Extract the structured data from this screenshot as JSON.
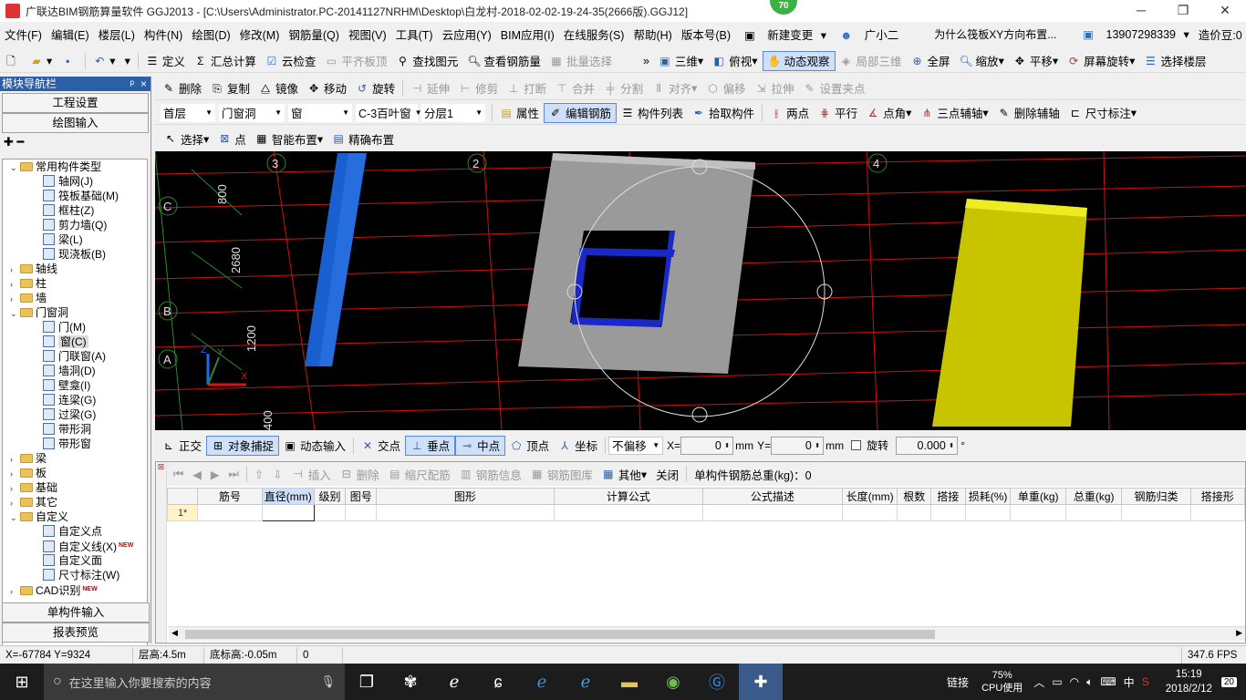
{
  "window": {
    "title": "广联达BIM钢筋算量软件 GGJ2013 - [C:\\Users\\Administrator.PC-20141127NRHM\\Desktop\\白龙村-2018-02-02-19-24-35(2666版).GGJ12]",
    "badge": "70",
    "minimize": "─",
    "restore": "❐",
    "close": "✕"
  },
  "menu": {
    "items": [
      "文件(F)",
      "编辑(E)",
      "楼层(L)",
      "构件(N)",
      "绘图(D)",
      "修改(M)",
      "钢筋量(Q)",
      "视图(V)",
      "工具(T)",
      "云应用(Y)",
      "BIM应用(I)",
      "在线服务(S)",
      "帮助(H)",
      "版本号(B)"
    ],
    "new_change": "新建变更",
    "assistant": "广小二",
    "question": "为什么筏板XY方向布置...",
    "phone": "13907298339",
    "beans": "造价豆:0"
  },
  "toolbar1": {
    "items": [
      "定义",
      "汇总计算",
      "云检查",
      "平齐板顶",
      "查找图元",
      "查看钢筋量",
      "批量选择"
    ],
    "view_items": [
      "三维",
      "俯视",
      "动态观察",
      "局部三维",
      "全屏",
      "缩放",
      "平移",
      "屏幕旋转",
      "选择楼层"
    ]
  },
  "toolbar2": {
    "items": [
      "删除",
      "复制",
      "镜像",
      "移动",
      "旋转",
      "延伸",
      "修剪",
      "打断",
      "合并",
      "分割",
      "对齐",
      "偏移",
      "拉伸",
      "设置夹点"
    ]
  },
  "toolbar3": {
    "floor": "首层",
    "category": "门窗洞",
    "type": "窗",
    "component": "C-3百叶窗",
    "layer": "分层1",
    "items": [
      "属性",
      "编辑钢筋",
      "构件列表",
      "拾取构件",
      "两点",
      "平行",
      "点角",
      "三点辅轴",
      "删除辅轴",
      "尺寸标注"
    ]
  },
  "toolbar4": {
    "items": [
      "选择",
      "点",
      "智能布置",
      "精确布置"
    ]
  },
  "left_panel": {
    "header": "模块导航栏",
    "header_pin": "ᵖ",
    "header_close": "×",
    "btn_project": "工程设置",
    "btn_draw": "绘图输入",
    "btn_single": "单构件输入",
    "btn_report": "报表预览",
    "tree": [
      {
        "label": "常用构件类型",
        "level": 0,
        "folder": true,
        "expanded": true
      },
      {
        "label": "轴网(J)",
        "level": 1
      },
      {
        "label": "筏板基础(M)",
        "level": 1
      },
      {
        "label": "框柱(Z)",
        "level": 1
      },
      {
        "label": "剪力墙(Q)",
        "level": 1
      },
      {
        "label": "梁(L)",
        "level": 1
      },
      {
        "label": "现浇板(B)",
        "level": 1
      },
      {
        "label": "轴线",
        "level": 0,
        "folder": true
      },
      {
        "label": "柱",
        "level": 0,
        "folder": true
      },
      {
        "label": "墙",
        "level": 0,
        "folder": true
      },
      {
        "label": "门窗洞",
        "level": 0,
        "folder": true,
        "expanded": true
      },
      {
        "label": "门(M)",
        "level": 1
      },
      {
        "label": "窗(C)",
        "level": 1,
        "selected": true
      },
      {
        "label": "门联窗(A)",
        "level": 1
      },
      {
        "label": "墙洞(D)",
        "level": 1
      },
      {
        "label": "壁龛(I)",
        "level": 1
      },
      {
        "label": "连梁(G)",
        "level": 1
      },
      {
        "label": "过梁(G)",
        "level": 1
      },
      {
        "label": "带形洞",
        "level": 1
      },
      {
        "label": "带形窗",
        "level": 1
      },
      {
        "label": "梁",
        "level": 0,
        "folder": true
      },
      {
        "label": "板",
        "level": 0,
        "folder": true
      },
      {
        "label": "基础",
        "level": 0,
        "folder": true
      },
      {
        "label": "其它",
        "level": 0,
        "folder": true
      },
      {
        "label": "自定义",
        "level": 0,
        "folder": true,
        "expanded": true
      },
      {
        "label": "自定义点",
        "level": 1
      },
      {
        "label": "自定义线(X)",
        "level": 1,
        "new": true
      },
      {
        "label": "自定义面",
        "level": 1
      },
      {
        "label": "尺寸标注(W)",
        "level": 1
      },
      {
        "label": "CAD识别",
        "level": 0,
        "folder": true,
        "new": true
      }
    ],
    "new_tag": "NEW"
  },
  "viewport": {
    "axis_top": [
      "3",
      "2",
      "4"
    ],
    "axis_left": [
      "C",
      "B",
      "A"
    ],
    "dims": [
      "800",
      "2680",
      "1200",
      "400"
    ],
    "axis_x": "X",
    "axis_y": "Y",
    "axis_z": "Z",
    "colors": {
      "background": "#000000",
      "grid": "#e01010",
      "pillar_blue": "#1a5fd0",
      "wall_gray": "#9a9a9a",
      "yellow_block": "#c8c400"
    }
  },
  "snap_bar": {
    "items": [
      "正交",
      "对象捕捉",
      "动态输入",
      "交点",
      "垂点",
      "中点",
      "顶点",
      "坐标"
    ],
    "offset_mode": "不偏移",
    "x_label": "X=",
    "x_value": "0",
    "x_unit": "mm",
    "y_label": "Y=",
    "y_value": "0",
    "y_unit": "mm",
    "rotate_label": "旋转",
    "rotate_value": "0.000",
    "rotate_unit": "°"
  },
  "rebar_grid": {
    "toolbar": [
      "插入",
      "删除",
      "缩尺配筋",
      "钢筋信息",
      "钢筋图库",
      "其他",
      "关闭"
    ],
    "total_label": "单构件钢筋总重(kg)：0",
    "columns": [
      "筋号",
      "直径(mm)",
      "级别",
      "图号",
      "图形",
      "计算公式",
      "公式描述",
      "长度(mm)",
      "根数",
      "搭接",
      "损耗(%)",
      "单重(kg)",
      "总重(kg)",
      "钢筋归类",
      "搭接形"
    ],
    "rows": [
      {
        "index": "1*"
      }
    ]
  },
  "status_bar": {
    "coords": "X=-67784 Y=9324",
    "floor_height": "层高:4.5m",
    "bottom_elev": "底标高:-0.05m",
    "value": "0",
    "fps": "347.6 FPS"
  },
  "taskbar": {
    "search_placeholder": "在这里输入你要搜索的内容",
    "link": "链接",
    "cpu_pct": "75%",
    "cpu_label": "CPU使用",
    "lang": "中",
    "time": "15:19",
    "date": "2018/2/12",
    "notif": "20"
  }
}
